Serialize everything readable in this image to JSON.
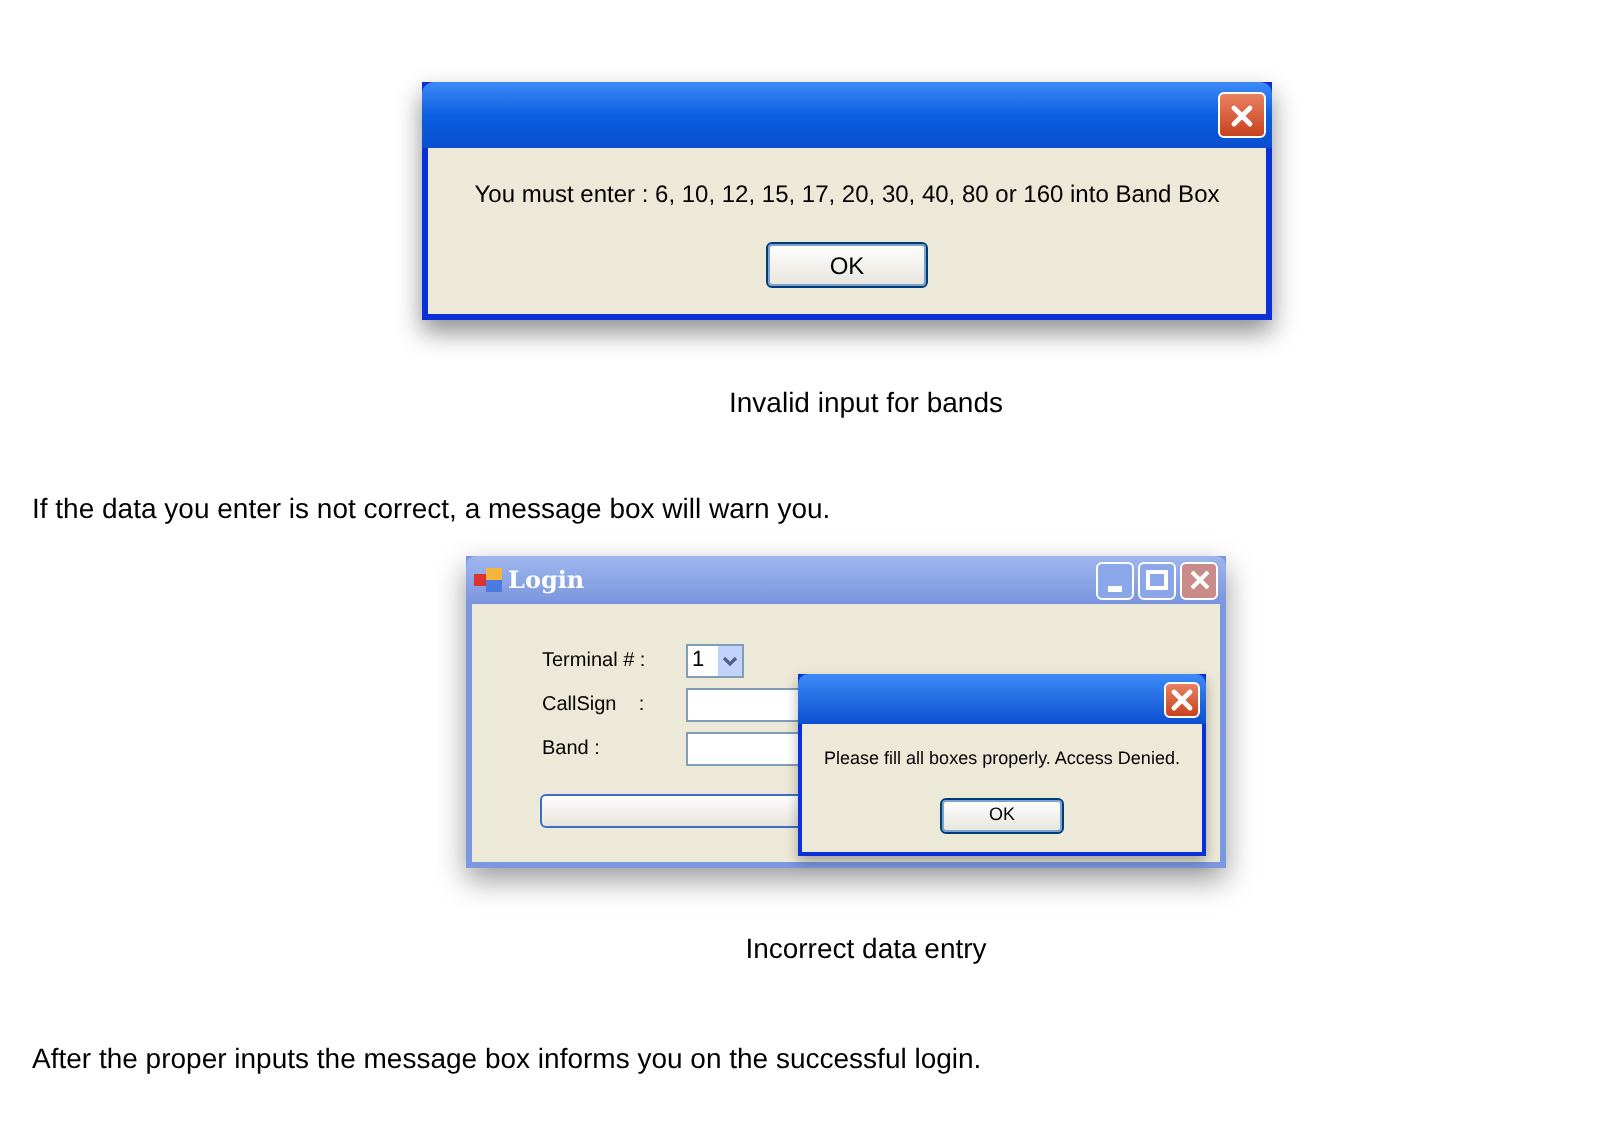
{
  "dialog": {
    "message": "You must enter : 6, 10, 12, 15, 17, 20, 30, 40, 80 or 160 into Band Box",
    "ok_button": "OK"
  },
  "caption_1": "Invalid input for bands",
  "paragraph_1": "If the data you enter is not correct, a message box will warn you.",
  "login_window": {
    "title": "Login",
    "fields": [
      {
        "label": "Terminal # :",
        "kind": "combo",
        "value": "1"
      },
      {
        "label": "CallSign    :",
        "kind": "text"
      },
      {
        "label": "Band :",
        "kind": "text"
      }
    ]
  },
  "message_box": {
    "message": "Please fill all boxes properly. Access Denied.",
    "ok_button": "OK"
  },
  "caption_2": "Incorrect data entry",
  "paragraph_2": "After the proper inputs the message box informs you on the successful login."
}
